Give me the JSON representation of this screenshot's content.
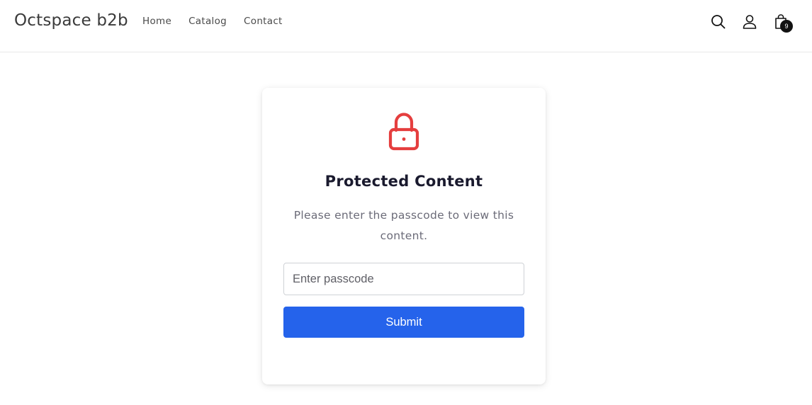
{
  "header": {
    "logo": "Octspace b2b",
    "nav": [
      {
        "label": "Home"
      },
      {
        "label": "Catalog"
      },
      {
        "label": "Contact"
      }
    ],
    "icons": {
      "search": "search-icon",
      "account": "user-icon",
      "cart": "shopping-bag-icon"
    },
    "cart_count": "9"
  },
  "card": {
    "icon": "lock-icon",
    "icon_color": "#e53e3e",
    "title": "Protected Content",
    "message": "Please enter the passcode to view this content.",
    "input": {
      "placeholder": "Enter passcode",
      "value": ""
    },
    "submit_label": "Submit",
    "button_color": "#2563eb"
  }
}
